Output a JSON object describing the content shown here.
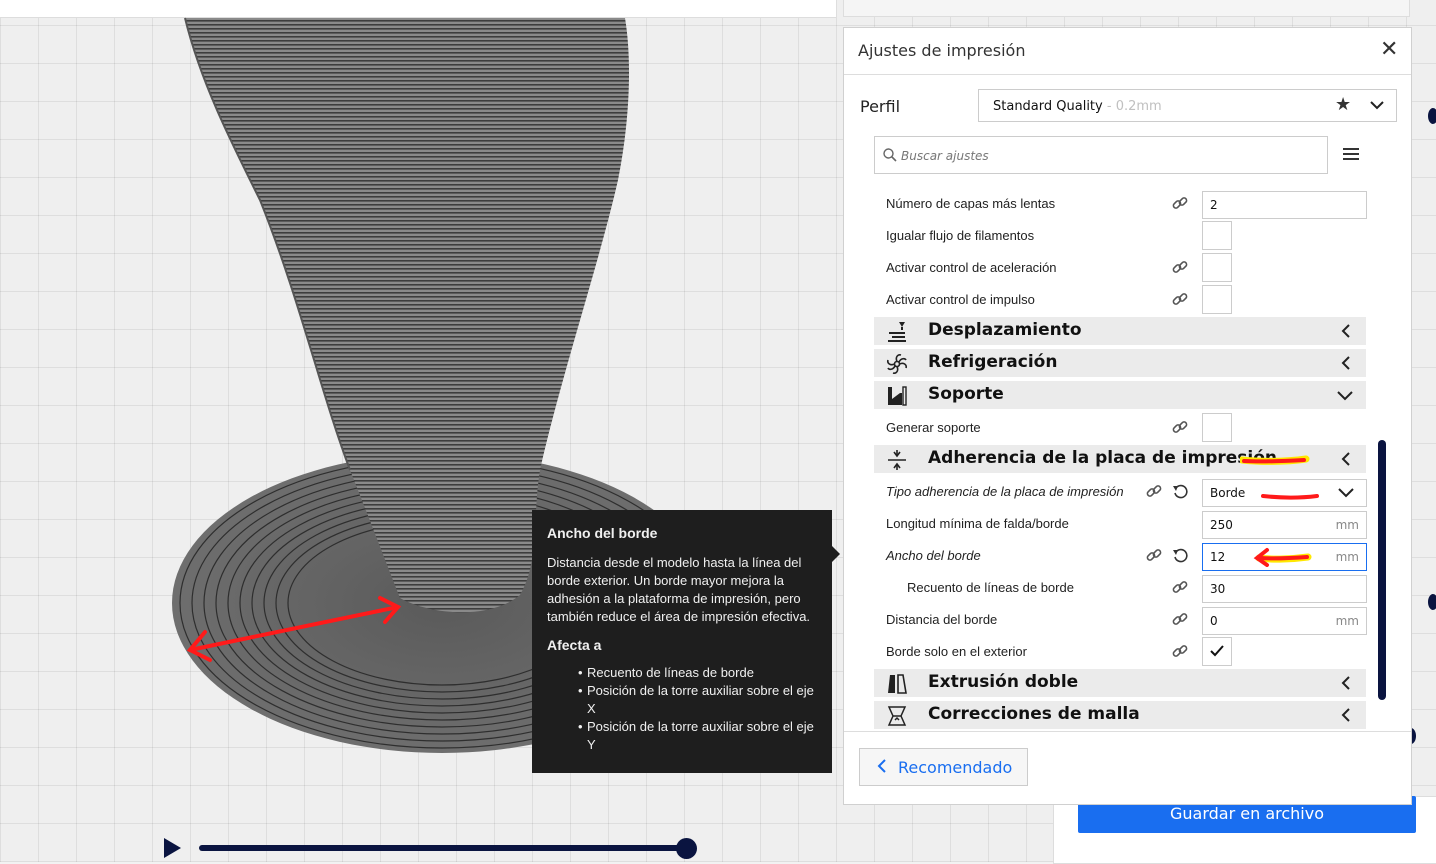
{
  "panel": {
    "title": "Ajustes de impresión",
    "profile_label": "Perfil",
    "profile_name": "Standard Quality",
    "profile_sub": " - 0.2mm",
    "search_placeholder": "Buscar ajustes",
    "footer_button": "Recomendado"
  },
  "settings": {
    "slower_layers": {
      "label": "Número de capas más lentas",
      "value": "2"
    },
    "equalize_flow": {
      "label": "Igualar flujo de filamentos"
    },
    "accel_control": {
      "label": "Activar control de aceleración"
    },
    "jerk_control": {
      "label": "Activar control de impulso"
    },
    "cat_travel": "Desplazamiento",
    "cat_cooling": "Refrigeración",
    "cat_support": "Soporte",
    "generate_support": {
      "label": "Generar soporte"
    },
    "cat_adhesion": "Adherencia de la placa de impresión",
    "adhesion_type": {
      "label": "Tipo adherencia de la placa de impresión",
      "value": "Borde"
    },
    "skirt_min_length": {
      "label": "Longitud mínima de falda/borde",
      "value": "250",
      "unit": "mm"
    },
    "brim_width": {
      "label": "Ancho del borde",
      "value": "12",
      "unit": "mm"
    },
    "brim_line_count": {
      "label": "Recuento de líneas de borde",
      "value": "30"
    },
    "brim_gap": {
      "label": "Distancia del borde",
      "value": "0",
      "unit": "mm"
    },
    "brim_outside_only": {
      "label": "Borde solo en el exterior",
      "checked": true
    },
    "cat_dual": "Extrusión doble",
    "cat_mesh": "Correcciones de malla"
  },
  "tooltip": {
    "title": "Ancho del borde",
    "description": "Distancia desde el modelo hasta la línea del borde exterior. Un borde mayor mejora la adhesión a la plataforma de impresión, pero también reduce el área de impresión efectiva.",
    "affects_title": "Afecta a",
    "affects": [
      "Recuento de líneas de borde",
      "Posición de la torre auxiliar sobre el eje X",
      "Posición de la torre auxiliar sobre el eje Y"
    ]
  },
  "actions": {
    "save_label": "Guardar en archivo",
    "drag_dots": "•••"
  },
  "colors": {
    "accent": "#196ef0",
    "dark": "#0a1440",
    "annotation_red": "#ff1a1a",
    "annotation_highlight": "#ffe800"
  }
}
